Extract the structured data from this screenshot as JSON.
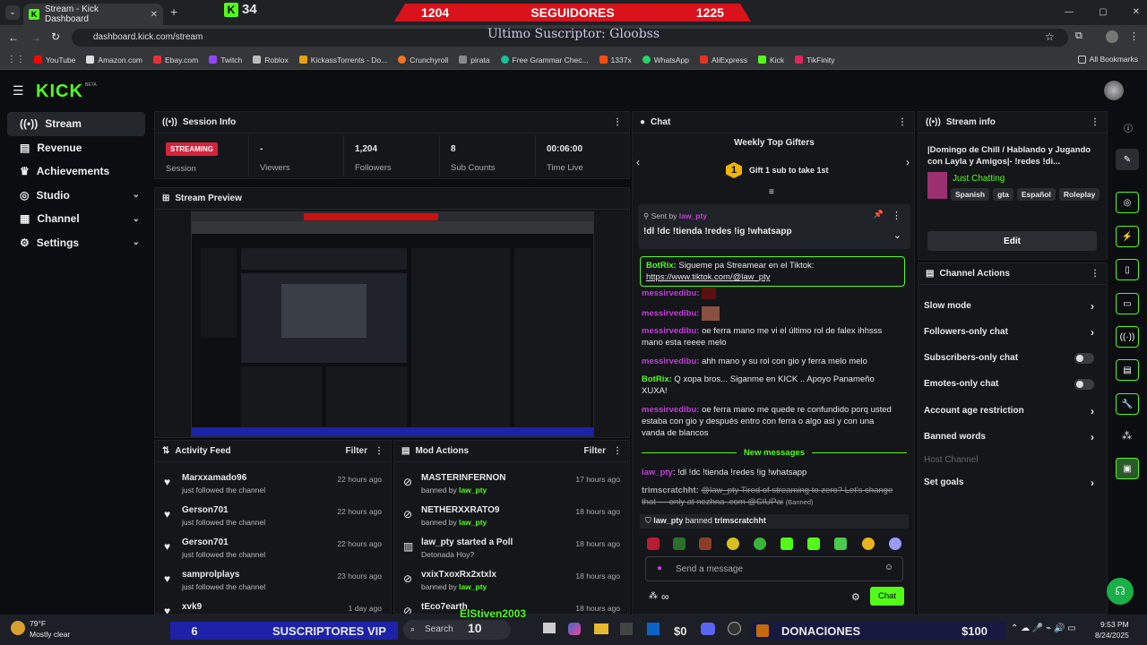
{
  "browser": {
    "tab_title": "Stream - Kick Dashboard",
    "new_tab": "+",
    "kick_counter": "34",
    "url": "dashboard.kick.com/stream",
    "overlay": {
      "left": "1204",
      "label": "SEGUIDORES",
      "right": "1225",
      "last_subscriber": "Ultimo Suscriptor: Gloobss"
    },
    "bookmarks": [
      "YouTube",
      "Amazon.com",
      "Ebay.com",
      "Twitch",
      "Roblox",
      "KickassTorrents - Do...",
      "Crunchyroll",
      "pirata",
      "Free Grammar Chec...",
      "1337x",
      "WhatsApp",
      "AliExpress",
      "Kick",
      "TikFinity"
    ],
    "all_bookmarks": "All Bookmarks"
  },
  "app": {
    "logo": "KICK",
    "logo_beta": "BETA",
    "sidebar": [
      {
        "label": "Stream",
        "icon": "stream-icon",
        "active": true
      },
      {
        "label": "Revenue",
        "icon": "revenue-icon"
      },
      {
        "label": "Achievements",
        "icon": "trophy-icon"
      },
      {
        "label": "Studio",
        "icon": "studio-icon",
        "chevron": true
      },
      {
        "label": "Channel",
        "icon": "channel-icon",
        "chevron": true
      },
      {
        "label": "Settings",
        "icon": "gear-icon",
        "chevron": true
      }
    ],
    "session": {
      "title": "Session Info",
      "status": "STREAMING",
      "session_label": "Session",
      "stats": [
        {
          "value": "-",
          "label": "Viewers"
        },
        {
          "value": "1,204",
          "label": "Followers"
        },
        {
          "value": "8",
          "label": "Sub Counts"
        },
        {
          "value": "00:06:00",
          "label": "Time Live"
        }
      ]
    },
    "preview": {
      "title": "Stream Preview"
    },
    "activity": {
      "title": "Activity Feed",
      "filter": "Filter",
      "items": [
        {
          "name": "Marxxamado96",
          "desc": "just followed the channel",
          "time": "22 hours ago"
        },
        {
          "name": "Gerson701",
          "desc": "just followed the channel",
          "time": "22 hours ago"
        },
        {
          "name": "Gerson701",
          "desc": "just followed the channel",
          "time": "22 hours ago"
        },
        {
          "name": "samprolplays",
          "desc": "just followed the channel",
          "time": "23 hours ago"
        },
        {
          "name": "xvk9",
          "desc": "",
          "time": "1 day ago"
        }
      ]
    },
    "mod": {
      "title": "Mod Actions",
      "filter": "Filter",
      "items": [
        {
          "name": "MASTERINFERNON",
          "desc": "banned by",
          "by": "law_pty",
          "time": "17 hours ago"
        },
        {
          "name": "NETHERXXRATO9",
          "desc": "banned by",
          "by": "law_pty",
          "time": "18 hours ago"
        },
        {
          "name": "law_pty started a Poll",
          "desc": "Detonada Hoy?",
          "by": "",
          "time": "18 hours ago"
        },
        {
          "name": "vxixTxoxRx2xtxlx",
          "desc": "banned by",
          "by": "law_pty",
          "time": "18 hours ago"
        },
        {
          "name": "tEco7earth",
          "desc": "",
          "by": "",
          "time": "18 hours ago"
        }
      ]
    },
    "chat": {
      "title": "Chat",
      "gifters_title": "Weekly Top Gifters",
      "gift_rank": "1",
      "gift_text": "Gift 1 sub to take 1st",
      "pinned_sent_by": "Sent by",
      "pinned_user": "law_pty",
      "pinned_msg": "!dl !dc !tienda !redes !ig !whatsapp",
      "msg1_user": "BotRix:",
      "msg1_text": "Sigueme pa Streamear en el Tiktok:",
      "msg1_link": "https://www.tiktok.com/@law_pty",
      "msg2_user": "messirvedibu:",
      "msg3_user": "messirvedibu:",
      "msg4_user": "messirvedibu:",
      "msg4_text": "oe ferra mano me vi el último rol de falex ihhsss mano esta reeee melo",
      "msg5_user": "messirvedibu:",
      "msg5_text": "ahh mano y su rol con gio y ferra melo melo",
      "msg6_user": "BotRix:",
      "msg6_text": "Q xopa bros... Siganme en KICK .. Apoyo Panameño XUXA!",
      "msg7_user": "messirvedibu:",
      "msg7_text": "oe ferra mano me quede re confundido porq usted estaba con gio y después entro con ferra o algo asi y con una vanda de blancos",
      "new_messages": "New messages",
      "msg8_user": "law_pty",
      "msg8_text": ": !dl !dc !tienda !redes !ig !whatsapp",
      "msg9_user": "trimscratchht:",
      "msg9_text": "@law_pty Tired of streaming to zero? Let's change that — only at nezhna .com @CIUPai",
      "msg9_banned": "(Banned)",
      "ban_notice_user": "law_pty",
      "ban_notice_text": "banned",
      "ban_notice_target": "trimscratchht",
      "placeholder": "Send a message",
      "send": "Chat",
      "infinity": "∞"
    },
    "stream_info": {
      "title": "Stream info",
      "stream_title": "|Domingo de Chill / Hablando y Jugando con Layla y Amigos|- !redes !di...",
      "category": "Just Chatting",
      "tags": [
        "Spanish",
        "gta",
        "Español",
        "Roleplay"
      ],
      "edit": "Edit"
    },
    "channel_actions": {
      "title": "Channel Actions",
      "items": [
        {
          "label": "Slow mode",
          "type": "chevron"
        },
        {
          "label": "Followers-only chat",
          "type": "chevron"
        },
        {
          "label": "Subscribers-only chat",
          "type": "toggle"
        },
        {
          "label": "Emotes-only chat",
          "type": "toggle"
        },
        {
          "label": "Account age restriction",
          "type": "chevron"
        },
        {
          "label": "Banned words",
          "type": "chevron"
        },
        {
          "label": "Host Channel",
          "type": "disabled"
        },
        {
          "label": "Set goals",
          "type": "chevron"
        }
      ]
    }
  },
  "taskbar": {
    "weather_temp": "79°F",
    "weather_desc": "Mostly clear",
    "vip_count": "6",
    "vip_label": "SUSCRIPTORES VIP",
    "search": "Search",
    "search_num": "10",
    "streamer_name": "ElStiven2003",
    "donations_prefix": "$0",
    "donations_label": "DONACIONES",
    "donations_value": "$100",
    "time": "9:53 PM",
    "date": "8/24/2025"
  },
  "colors": {
    "kick_green": "#53fc18",
    "overlay_red": "#d9121b",
    "streaming_badge": "#d8233c",
    "vip_blue": "#1d22a8"
  }
}
